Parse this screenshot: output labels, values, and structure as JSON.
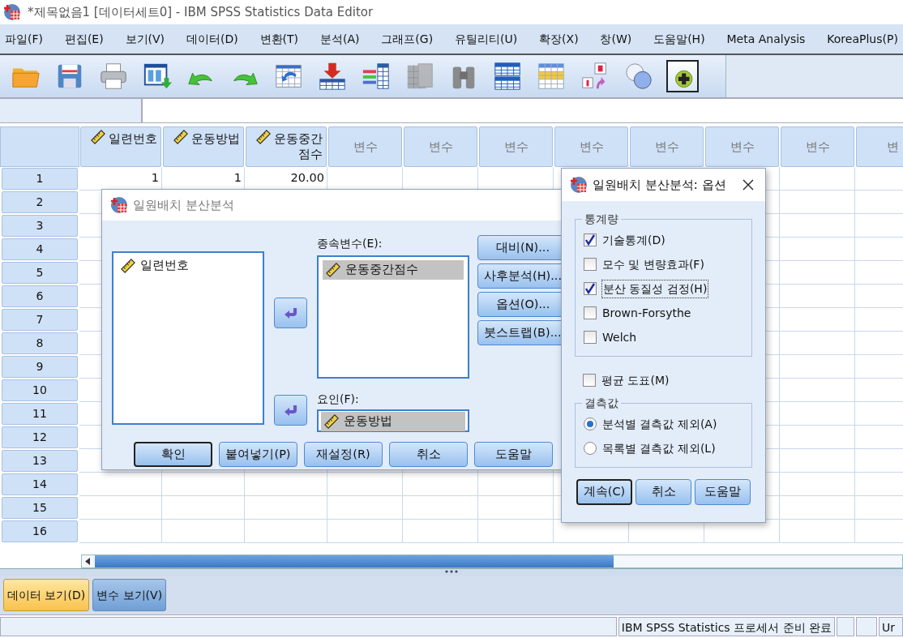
{
  "window": {
    "title": "*제목없음1 [데이터세트0] - IBM SPSS Statistics Data Editor"
  },
  "menu": [
    "파일(F)",
    "편집(E)",
    "보기(V)",
    "데이터(D)",
    "변환(T)",
    "분석(A)",
    "그래프(G)",
    "유틸리티(U)",
    "확장(X)",
    "창(W)",
    "도움말(H)",
    "Meta Analysis",
    "KoreaPlus(P)"
  ],
  "toolbar": [
    {
      "kind": "open",
      "disabled": false,
      "pressed": false
    },
    {
      "kind": "save",
      "disabled": false,
      "pressed": false
    },
    {
      "kind": "print",
      "disabled": false,
      "pressed": false
    },
    {
      "kind": "recall",
      "disabled": false,
      "pressed": false
    },
    {
      "kind": "undo",
      "disabled": false,
      "pressed": false
    },
    {
      "kind": "redo",
      "disabled": false,
      "pressed": false
    },
    {
      "kind": "goto",
      "disabled": false,
      "pressed": false
    },
    {
      "kind": "insert-case",
      "disabled": false,
      "pressed": false
    },
    {
      "kind": "insert-variable",
      "disabled": false,
      "pressed": false
    },
    {
      "kind": "split",
      "disabled": true,
      "pressed": false
    },
    {
      "kind": "find",
      "disabled": false,
      "pressed": false
    },
    {
      "kind": "split-file",
      "disabled": false,
      "pressed": false
    },
    {
      "kind": "select",
      "disabled": false,
      "pressed": false
    },
    {
      "kind": "labels",
      "disabled": false,
      "pressed": false
    },
    {
      "kind": "sets",
      "disabled": false,
      "pressed": false
    },
    {
      "kind": "extension",
      "disabled": false,
      "pressed": true
    }
  ],
  "grid": {
    "columns": [
      {
        "label": "일련번호",
        "kind": "variable"
      },
      {
        "label": "운동방법",
        "kind": "variable"
      },
      {
        "label": "운동중간점수",
        "kind": "variable"
      },
      {
        "label": "변수",
        "kind": "placeholder"
      },
      {
        "label": "변수",
        "kind": "placeholder"
      },
      {
        "label": "변수",
        "kind": "placeholder"
      },
      {
        "label": "변수",
        "kind": "placeholder"
      },
      {
        "label": "변수",
        "kind": "placeholder"
      },
      {
        "label": "변수",
        "kind": "placeholder"
      },
      {
        "label": "변수",
        "kind": "placeholder"
      },
      {
        "label": "변",
        "kind": "placeholder"
      }
    ],
    "rows": [
      {
        "label": "1",
        "cells": [
          "1",
          "1",
          "20.00"
        ]
      },
      {
        "label": "2"
      },
      {
        "label": "3"
      },
      {
        "label": "4"
      },
      {
        "label": "5"
      },
      {
        "label": "6"
      },
      {
        "label": "7"
      },
      {
        "label": "8"
      },
      {
        "label": "9"
      },
      {
        "label": "10"
      },
      {
        "label": "11"
      },
      {
        "label": "12"
      },
      {
        "label": "13"
      },
      {
        "label": "14"
      },
      {
        "label": "15"
      },
      {
        "label": "16"
      }
    ]
  },
  "tabs": [
    {
      "label": "데이터 보기(D)",
      "selected": true
    },
    {
      "label": "변수 보기(V)",
      "selected": false
    }
  ],
  "status_bar": {
    "message": "IBM SPSS Statistics 프로세서 준비 완료",
    "column_4": "Ur"
  },
  "anova_dialog": {
    "title": "일원배치 분산분석",
    "variables": [
      {
        "name": "일련번호",
        "selected": false
      }
    ],
    "dependent_label": "종속변수(E):",
    "dependents": [
      {
        "name": "운동중간점수",
        "selected": true
      }
    ],
    "factor_label": "요인(F):",
    "factor": {
      "name": "운동방법",
      "selected": true
    },
    "side_buttons": [
      "대비(N)...",
      "사후분석(H)...",
      "옵션(O)...",
      "붓스트랩(B)..."
    ],
    "buttons": [
      {
        "label": "확인",
        "default": true
      },
      {
        "label": "붙여넣기(P)",
        "default": false
      },
      {
        "label": "재설정(R)",
        "default": false
      },
      {
        "label": "취소",
        "default": false
      },
      {
        "label": "도움말",
        "default": false
      }
    ]
  },
  "options_dialog": {
    "title": "일원배치 분산분석: 옵션",
    "statistics_group": "통계량",
    "statistics": [
      {
        "label": "기술통계(D)",
        "checked": true,
        "focused": false
      },
      {
        "label": "모수 및 변량효과(F)",
        "checked": false,
        "focused": false
      },
      {
        "label": "분산 동질성 검정(H)",
        "checked": true,
        "focused": true
      },
      {
        "label": "Brown-Forsythe",
        "checked": false,
        "focused": false
      },
      {
        "label": "Welch",
        "checked": false,
        "focused": false
      }
    ],
    "means_plot": {
      "label": "평균 도표(M)",
      "checked": false
    },
    "missing_group": "결측값",
    "missing": [
      {
        "label": "분석별 결측값 제외(A)",
        "selected": true
      },
      {
        "label": "목록별 결측값 제외(L)",
        "selected": false
      }
    ],
    "buttons": [
      {
        "label": "계속(C)",
        "default": true
      },
      {
        "label": "취소",
        "default": false
      },
      {
        "label": "도움말",
        "default": false
      }
    ]
  }
}
